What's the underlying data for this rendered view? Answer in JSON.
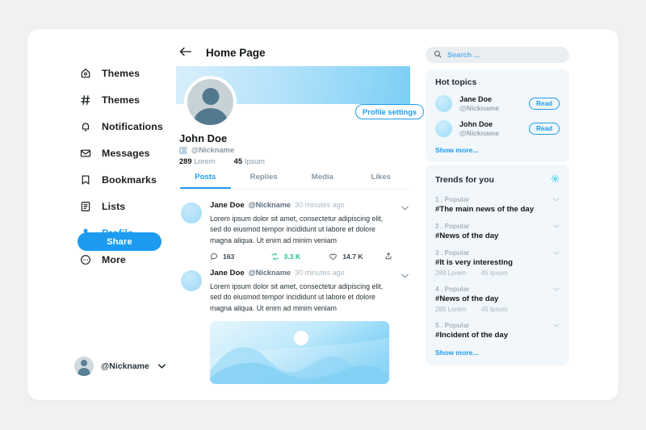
{
  "sidebar": {
    "items": [
      {
        "label": "Themes",
        "icon": "home-icon",
        "active": false
      },
      {
        "label": "Themes",
        "icon": "hash-icon",
        "active": false
      },
      {
        "label": "Notifications",
        "icon": "bell-icon",
        "active": false
      },
      {
        "label": "Messages",
        "icon": "envelope-icon",
        "active": false
      },
      {
        "label": "Bookmarks",
        "icon": "bookmark-icon",
        "active": false
      },
      {
        "label": "Lists",
        "icon": "list-icon",
        "active": false
      },
      {
        "label": "Profile",
        "icon": "person-icon",
        "active": true
      },
      {
        "label": "More",
        "icon": "more-circle-icon",
        "active": false
      }
    ],
    "share_label": "Share",
    "user": {
      "handle": "@Nickname",
      "chevron": "⌄"
    }
  },
  "header": {
    "back_icon": "arrow-left-icon",
    "title": "Home Page"
  },
  "profile": {
    "settings_label": "Profile settings",
    "name": "John Doe",
    "handle": "@Nickname",
    "stats": [
      {
        "value": "289",
        "label": "Lorem"
      },
      {
        "value": "45",
        "label": "Ipsum"
      }
    ],
    "tabs": [
      {
        "label": "Posts",
        "active": true
      },
      {
        "label": "Replies",
        "active": false
      },
      {
        "label": "Media",
        "active": false
      },
      {
        "label": "Likes",
        "active": false
      }
    ]
  },
  "feed": {
    "posts": [
      {
        "name": "Jane Doe",
        "handle": "@Nickname",
        "time": "30 minutes ago",
        "text": "Lorem ipsum dolor sit amet, consectetur adipiscing elit, sed do eiusmod tempor incididunt ut labore et dolore magna aliqua. Ut enim ad minim veniam",
        "actions": {
          "comments": "163",
          "retweets": "3.3 K",
          "likes": "14.7 K",
          "share_icon": "share-icon"
        }
      },
      {
        "name": "Jane Doe",
        "handle": "@Nickname",
        "time": "30 minutes ago",
        "text": "Lorem ipsum dolor sit amet, consectetur adipiscing elit, sed do eiusmod tempor incididunt ut labore et dolore magna aliqua. Ut enim ad minim veniam",
        "has_image": true
      }
    ]
  },
  "search": {
    "placeholder": "Search ...",
    "value": "",
    "icon": "search-icon"
  },
  "hot_topics": {
    "title": "Hot topics",
    "rows": [
      {
        "name": "Jane Doe",
        "handle": "@Nickname",
        "button": "Read"
      },
      {
        "name": "John Doe",
        "handle": "@Nickname",
        "button": "Read"
      }
    ],
    "show_more": "Show more..."
  },
  "trends": {
    "title": "Trends for you",
    "gear_icon": "gear-icon",
    "items": [
      {
        "rank": "1 .  Popular",
        "tag": "#The main news of the day",
        "stats": null
      },
      {
        "rank": "2 .  Popular",
        "tag": "#News of the day",
        "stats": null
      },
      {
        "rank": "3 .  Popular",
        "tag": "#It is very interesting",
        "stats": {
          "a_value": "289",
          "a_label": "Lorem",
          "b_value": "45",
          "b_label": "Ipsum"
        }
      },
      {
        "rank": "4 .  Popular",
        "tag": "#News of the day",
        "stats": {
          "a_value": "289",
          "a_label": "Lorem",
          "b_value": "45",
          "b_label": "Ipsum"
        }
      },
      {
        "rank": "5 .  Popular",
        "tag": "#Incident of the day",
        "stats": null
      }
    ],
    "show_more": "Show more..."
  },
  "colors": {
    "accent": "#1d9bf0",
    "retweet_green": "#17bf8f",
    "panel_bg": "#f1f7fa",
    "page_bg": "#f1f1f1",
    "muted": "#8899a6"
  }
}
